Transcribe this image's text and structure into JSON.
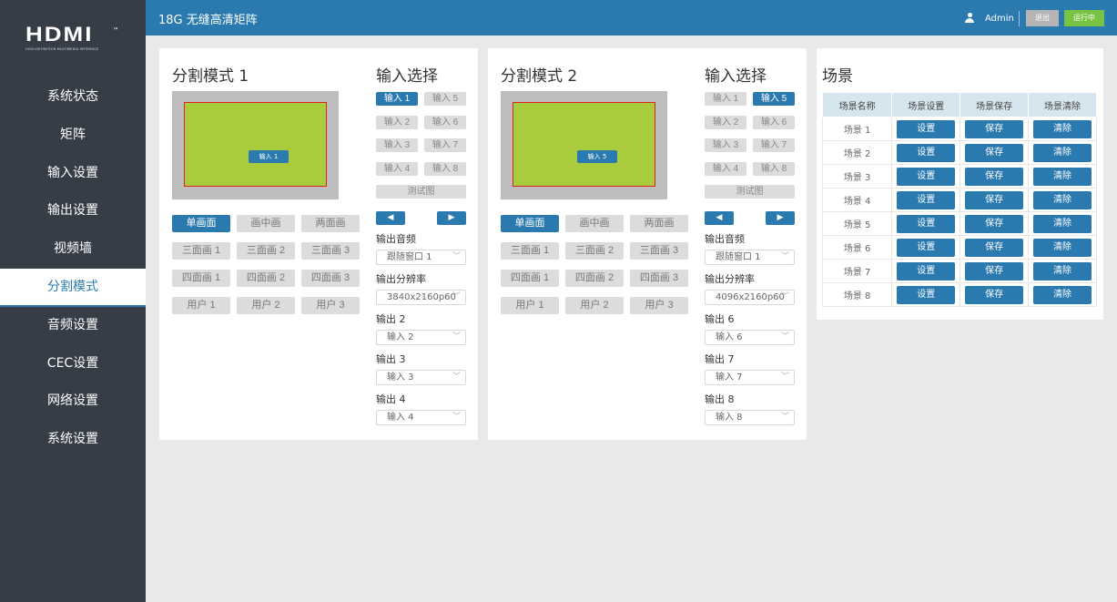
{
  "header": {
    "title": "18G 无缝高清矩阵",
    "user": "Admin",
    "logout_label": "退出",
    "status_label": "运行中"
  },
  "logo": {
    "word": "HDMI",
    "tm": "™",
    "tagline": "HIGH-DEFINITION MULTIMEDIA INTERFACE"
  },
  "sidebar": {
    "items": [
      {
        "label": "系统状态"
      },
      {
        "label": "矩阵"
      },
      {
        "label": "输入设置"
      },
      {
        "label": "输出设置"
      },
      {
        "label": "视频墙"
      },
      {
        "label": "分割模式",
        "active": true
      },
      {
        "label": "音频设置"
      },
      {
        "label": "CEC设置"
      },
      {
        "label": "网络设置"
      },
      {
        "label": "系统设置"
      }
    ]
  },
  "modes": [
    {
      "title": "分割模式 1",
      "preview_label": "输入 1",
      "layout_buttons": [
        "单画面",
        "画中画",
        "两面画",
        "三面画 1",
        "三面画 2",
        "三面画 3",
        "四面画 1",
        "四面画 2",
        "四面画 3",
        "用户 1",
        "用户 2",
        "用户 3"
      ],
      "active_layout": 0,
      "input_title": "输入选择",
      "inputs": [
        "输入 1",
        "输入 5",
        "输入 2",
        "输入 6",
        "输入 3",
        "输入 7",
        "输入 4",
        "输入 8"
      ],
      "active_input": 0,
      "test_pattern": "测试图",
      "prev_arrow": "◀",
      "next_arrow": "▶",
      "audio_label": "输出音频",
      "audio_value": "跟随窗口 1",
      "resolution_label": "输出分辨率",
      "resolution_value": "3840x2160p60",
      "outputs": [
        {
          "label": "输出 2",
          "value": "输入 2"
        },
        {
          "label": "输出 3",
          "value": "输入 3"
        },
        {
          "label": "输出 4",
          "value": "输入 4"
        }
      ]
    },
    {
      "title": "分割模式 2",
      "preview_label": "输入 5",
      "layout_buttons": [
        "单画面",
        "画中画",
        "两面画",
        "三面画 1",
        "三面画 2",
        "三面画 3",
        "四面画 1",
        "四面画 2",
        "四面画 3",
        "用户 1",
        "用户 2",
        "用户 3"
      ],
      "active_layout": 0,
      "input_title": "输入选择",
      "inputs": [
        "输入 1",
        "输入 5",
        "输入 2",
        "输入 6",
        "输入 3",
        "输入 7",
        "输入 4",
        "输入 8"
      ],
      "active_input": 1,
      "test_pattern": "测试图",
      "prev_arrow": "◀",
      "next_arrow": "▶",
      "audio_label": "输出音频",
      "audio_value": "跟随窗口 1",
      "resolution_label": "输出分辨率",
      "resolution_value": "4096x2160p60",
      "outputs": [
        {
          "label": "输出 6",
          "value": "输入 6"
        },
        {
          "label": "输出 7",
          "value": "输入 7"
        },
        {
          "label": "输出 8",
          "value": "输入 8"
        }
      ]
    }
  ],
  "scenes": {
    "title": "场景",
    "headers": [
      "场景名称",
      "场景设置",
      "场景保存",
      "场景清除"
    ],
    "set_label": "设置",
    "save_label": "保存",
    "clear_label": "清除",
    "rows": [
      "场景 1",
      "场景 2",
      "场景 3",
      "场景 4",
      "场景 5",
      "场景 6",
      "场景 7",
      "场景 8"
    ]
  },
  "colors": {
    "primary": "#2a7ab0",
    "sidebar": "#363d47",
    "status_green": "#78c341",
    "preview_window": "#a8cc3d",
    "preview_border": "#e02020"
  }
}
